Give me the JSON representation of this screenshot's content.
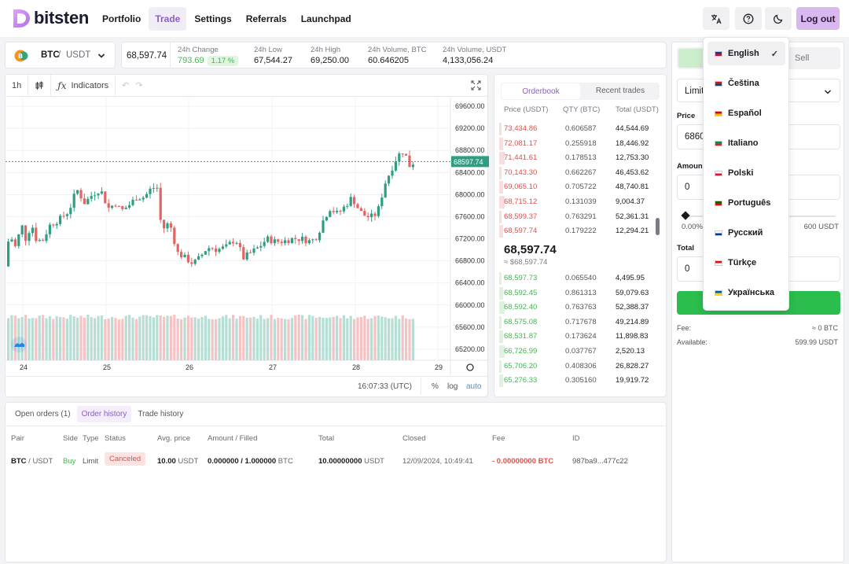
{
  "brand": {
    "name": "bitsten"
  },
  "nav": {
    "items": [
      "Portfolio",
      "Trade",
      "Settings",
      "Referrals",
      "Launchpad"
    ],
    "active": 1
  },
  "header": {
    "logout": "Log out"
  },
  "pair": {
    "base": "BTC",
    "sep": " / ",
    "quote": "USDT"
  },
  "ticker": {
    "price": "68,597.74",
    "change_label": "24h Change",
    "change_value": "793.69",
    "change_pct": "1.17 %",
    "low_label": "24h Low",
    "low_value": "67,544.27",
    "high_label": "24h High",
    "high_value": "69,250.00",
    "vol_btc_label": "24h Volume, BTC",
    "vol_btc_value": "60.646205",
    "vol_usdt_label": "24h Volume, USDT",
    "vol_usdt_value": "4,133,056.24"
  },
  "chart_toolbar": {
    "interval": "1h",
    "indicators": "Indicators"
  },
  "chart_data": {
    "type": "candlestick",
    "price_ticks": [
      "69600.00",
      "69200.00",
      "68800.00",
      "68400.00",
      "68000.00",
      "67600.00",
      "67200.00",
      "66800.00",
      "66400.00",
      "66000.00",
      "65600.00",
      "65200.00"
    ],
    "date_ticks": [
      "24",
      "25",
      "26",
      "27",
      "28",
      "29"
    ],
    "last_price_label": "68597.74",
    "ylim": [
      65000,
      69700
    ]
  },
  "chart_footer": {
    "time": "16:07:33 (UTC)",
    "pct": "%",
    "log": "log",
    "auto": "auto"
  },
  "orderbook": {
    "tabs": [
      "Orderbook",
      "Recent trades"
    ],
    "headers": [
      "Price (USDT)",
      "QTY (BTC)",
      "Total (USDT)"
    ],
    "asks": [
      {
        "price": "73,434.86",
        "qty": "0.606587",
        "total": "44,544.69"
      },
      {
        "price": "72,081.17",
        "qty": "0.255918",
        "total": "18,446.92"
      },
      {
        "price": "71,441.61",
        "qty": "0.178513",
        "total": "12,753.30"
      },
      {
        "price": "70,143.30",
        "qty": "0.662267",
        "total": "46,453.62"
      },
      {
        "price": "69,065.10",
        "qty": "0.705722",
        "total": "48,740.81"
      },
      {
        "price": "68,715.12",
        "qty": "0.131039",
        "total": "9,004.37"
      },
      {
        "price": "68,599.37",
        "qty": "0.763291",
        "total": "52,361.31"
      },
      {
        "price": "68,597.74",
        "qty": "0.179222",
        "total": "12,294.21"
      }
    ],
    "last": "68,597.74",
    "last_sub": "≈ $68,597.74",
    "bids": [
      {
        "price": "68,597.73",
        "qty": "0.065540",
        "total": "4,495.95"
      },
      {
        "price": "68,592.45",
        "qty": "0.861313",
        "total": "59,079.63"
      },
      {
        "price": "68,592.40",
        "qty": "0.763763",
        "total": "52,388.37"
      },
      {
        "price": "68,575.08",
        "qty": "0.717678",
        "total": "49,214.89"
      },
      {
        "price": "68,531.87",
        "qty": "0.173624",
        "total": "11,898.83"
      },
      {
        "price": "66,726.99",
        "qty": "0.037767",
        "total": "2,520.13"
      },
      {
        "price": "65,706.20",
        "qty": "0.408306",
        "total": "26,828.27"
      },
      {
        "price": "65,276.33",
        "qty": "0.305160",
        "total": "19,919.72"
      }
    ]
  },
  "trade_form": {
    "sell": "Sell",
    "type": "Limit",
    "price_label": "Price",
    "price_value": "6860",
    "amount_label": "Amount",
    "amount_value": "0",
    "slider_min": "0.00%",
    "slider_max": "600 USDT",
    "total_label": "Total",
    "total_value": "0",
    "fee_label": "Fee:",
    "fee_value": "≈ 0 BTC",
    "avail_label": "Available:",
    "avail_value": "599.99 USDT"
  },
  "languages": {
    "items": [
      "English",
      "Čeština",
      "Español",
      "Italiano",
      "Polski",
      "Português",
      "Русский",
      "Türkçe",
      "Українська"
    ],
    "selected": 0
  },
  "bottom": {
    "tabs": [
      "Open orders (1)",
      "Order history",
      "Trade history"
    ],
    "active": 1,
    "headers": [
      "Pair",
      "Side",
      "Type",
      "Status",
      "Avg. price",
      "Amount / Filled",
      "Total",
      "Closed",
      "Fee",
      "ID"
    ],
    "row": {
      "pair_base": "BTC",
      "pair_quote": " / USDT",
      "side": "Buy",
      "type": "Limit",
      "status": "Canceled",
      "avg": "10.00",
      "avg_unit": " USDT",
      "amount": "0.000000 / 1.000000",
      "amount_unit": " BTC",
      "total": "10.00000000",
      "total_unit": " USDT",
      "closed": "12/09/2024, 10:49:41",
      "fee": "- 0.00000000 BTC",
      "id": "987ba9...477c22"
    }
  },
  "colors": {
    "accent": "#8a5fc4",
    "up": "#3fb950",
    "down": "#d9534f"
  }
}
